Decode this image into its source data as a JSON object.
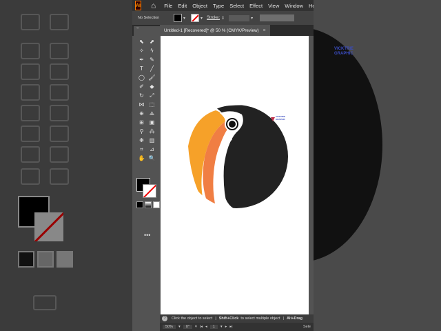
{
  "menubar": {
    "logo": "Ai",
    "menus": [
      "File",
      "Edit",
      "Object",
      "Type",
      "Select",
      "Effect",
      "View",
      "Window",
      "Help"
    ]
  },
  "control_bar": {
    "selection_status": "No Selection",
    "stroke_label": "Stroke:"
  },
  "document_tab": {
    "title": "Untitled-1 [Recovered]* @ 50 % (CMYK/Preview)",
    "close": "×"
  },
  "toolbar": {
    "header": "«",
    "more": "•••"
  },
  "canvas": {
    "watermark_line1": "VICKTRIE",
    "watermark_line2": "GRAPHIC",
    "colors": {
      "body": "#222222",
      "beak_yellow": "#f6a129",
      "beak_orange": "#f07e43",
      "white": "#ffffff"
    }
  },
  "status_bar": {
    "help_icon": "?",
    "message_1": "Click the object to select",
    "separator": "|",
    "message_2_bold": "Shift+Click",
    "message_2_rest": "to select multiple object",
    "message_3_bold": "Alt+Drag"
  },
  "bottom_bar": {
    "zoom": "50%",
    "rotation": "0°",
    "artboard_number": "1",
    "selection_label": "Sele"
  },
  "background": {
    "right_watermark_line1": "VICKTRIE",
    "right_watermark_line2": "GRAPHIC"
  }
}
